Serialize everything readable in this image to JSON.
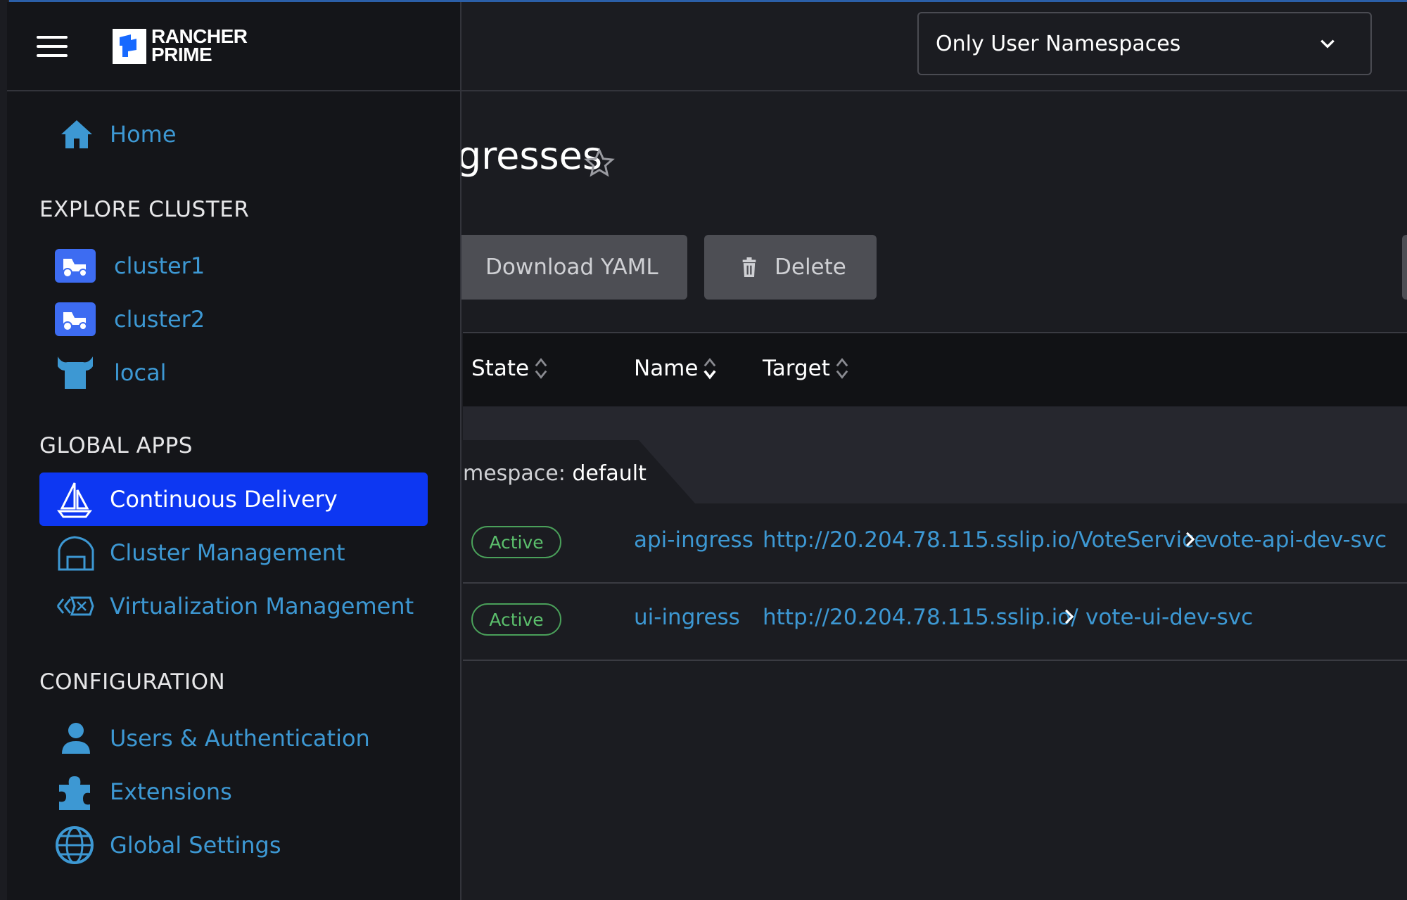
{
  "namespace_filter": {
    "selected": "Only User Namespaces"
  },
  "page": {
    "title_visible": "gresses"
  },
  "actions": {
    "download_yaml": "Download YAML",
    "delete": "Delete"
  },
  "table": {
    "columns": {
      "state": "State",
      "name": "Name",
      "target": "Target"
    },
    "group": {
      "prefix": "mespace:",
      "value": "default"
    },
    "rows": [
      {
        "state": "Active",
        "name": "api-ingress",
        "target_url": "http://20.204.78.115.sslip.io/VoteService",
        "target_service": "vote-api-dev-svc"
      },
      {
        "state": "Active",
        "name": "ui-ingress",
        "target_url": "http://20.204.78.115.sslip.io/",
        "target_service": "vote-ui-dev-svc"
      }
    ]
  },
  "sidenav": {
    "logo_line1": "RANCHER",
    "logo_line2": "PRIME",
    "home": "Home",
    "sections": {
      "explore": "EXPLORE CLUSTER",
      "global_apps": "GLOBAL APPS",
      "configuration": "CONFIGURATION"
    },
    "clusters": [
      {
        "label": "cluster1",
        "icon": "cluster-tractor-icon"
      },
      {
        "label": "cluster2",
        "icon": "cluster-tractor-icon"
      },
      {
        "label": "local",
        "icon": "local-cow-icon"
      }
    ],
    "global_apps": [
      {
        "label": "Continuous Delivery",
        "icon": "sailboat-icon",
        "active": true
      },
      {
        "label": "Cluster Management",
        "icon": "barn-icon"
      },
      {
        "label": "Virtualization Management",
        "icon": "virtualization-icon"
      }
    ],
    "configuration": [
      {
        "label": "Users & Authentication",
        "icon": "user-icon"
      },
      {
        "label": "Extensions",
        "icon": "puzzle-icon"
      },
      {
        "label": "Global Settings",
        "icon": "globe-icon"
      }
    ]
  },
  "colors": {
    "accent": "#0d37f2",
    "link": "#3d98d3",
    "active_badge": "#5bbf6c"
  }
}
